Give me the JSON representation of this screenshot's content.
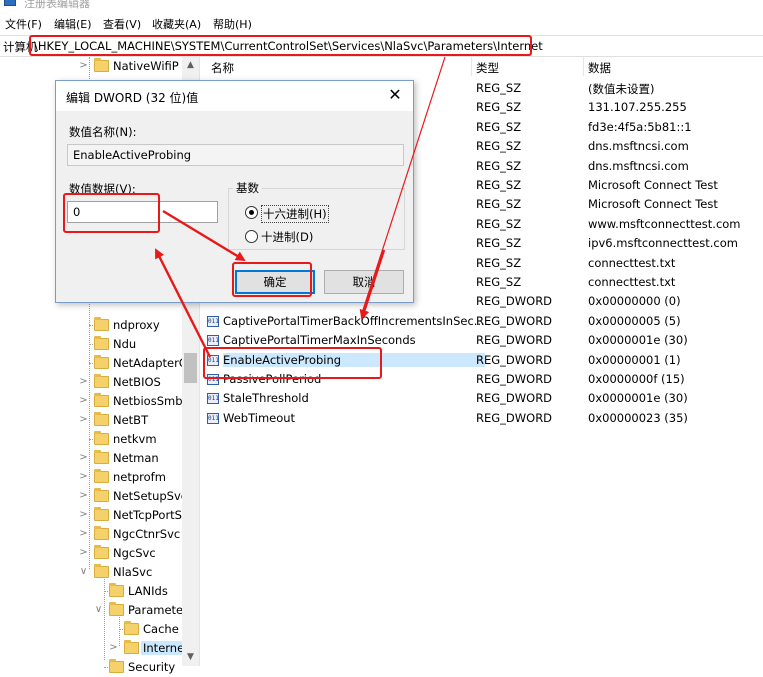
{
  "app": {
    "title": "注册表编辑器"
  },
  "menu": [
    "文件(F)",
    "编辑(E)",
    "查看(V)",
    "收藏夹(A)",
    "帮助(H)"
  ],
  "address": {
    "label": "计算机",
    "path": "\\HKEY_LOCAL_MACHINE\\SYSTEM\\CurrentControlSet\\Services\\NlaSvc\\Parameters\\Internet"
  },
  "tree": {
    "items": [
      {
        "label": "NativeWifiP",
        "has_children": true
      },
      {
        "label": "ndproxy",
        "has_children": false
      },
      {
        "label": "Ndu",
        "has_children": false
      },
      {
        "label": "NetAdapterC",
        "has_children": false
      },
      {
        "label": "NetBIOS",
        "has_children": true
      },
      {
        "label": "NetbiosSmb",
        "has_children": true
      },
      {
        "label": "NetBT",
        "has_children": true
      },
      {
        "label": "netkvm",
        "has_children": false
      },
      {
        "label": "Netman",
        "has_children": true
      },
      {
        "label": "netprofm",
        "has_children": true
      },
      {
        "label": "NetSetupSvc",
        "has_children": true
      },
      {
        "label": "NetTcpPortSl",
        "has_children": true
      },
      {
        "label": "NgcCtnrSvc",
        "has_children": true
      },
      {
        "label": "NgcSvc",
        "has_children": true
      },
      {
        "label": "NlaSvc",
        "expanded": true
      },
      {
        "label": "LANIds",
        "has_children": false
      },
      {
        "label": "Parameter",
        "expanded": true
      },
      {
        "label": "Cache",
        "has_children": false
      },
      {
        "label": "Internet",
        "has_children": true,
        "selected": true
      },
      {
        "label": "Security",
        "has_children": false
      }
    ]
  },
  "list": {
    "columns": {
      "name": "名称",
      "type": "类型",
      "data": "数据"
    },
    "rows": [
      {
        "name": "",
        "type": "REG_SZ",
        "data": "(数值未设置)"
      },
      {
        "name": "",
        "type": "REG_SZ",
        "data": "131.107.255.255"
      },
      {
        "name": "",
        "type": "REG_SZ",
        "data": "fd3e:4f5a:5b81::1"
      },
      {
        "name": "",
        "type": "REG_SZ",
        "data": "dns.msftncsi.com"
      },
      {
        "name": "",
        "type": "REG_SZ",
        "data": "dns.msftncsi.com"
      },
      {
        "name": "",
        "type": "REG_SZ",
        "data": "Microsoft Connect Test"
      },
      {
        "name": "",
        "type": "REG_SZ",
        "data": "Microsoft Connect Test"
      },
      {
        "name": "",
        "type": "REG_SZ",
        "data": "www.msftconnecttest.com"
      },
      {
        "name": "",
        "type": "REG_SZ",
        "data": "ipv6.msftconnecttest.com"
      },
      {
        "name": "",
        "type": "REG_SZ",
        "data": "connecttest.txt"
      },
      {
        "name": "",
        "type": "REG_SZ",
        "data": "connecttest.txt"
      },
      {
        "name": "",
        "type": "REG_DWORD",
        "data": "0x00000000 (0)"
      },
      {
        "name": "CaptivePortalTimerBackOffIncrementsInSec...",
        "type": "REG_DWORD",
        "data": "0x00000005 (5)"
      },
      {
        "name": "CaptivePortalTimerMaxInSeconds",
        "type": "REG_DWORD",
        "data": "0x0000001e (30)"
      },
      {
        "name": "EnableActiveProbing",
        "type": "REG_DWORD",
        "data": "0x00000001 (1)",
        "selected": true
      },
      {
        "name": "PassivePollPeriod",
        "type": "REG_DWORD",
        "data": "0x0000000f (15)"
      },
      {
        "name": "StaleThreshold",
        "type": "REG_DWORD",
        "data": "0x0000001e (30)"
      },
      {
        "name": "WebTimeout",
        "type": "REG_DWORD",
        "data": "0x00000023 (35)"
      }
    ]
  },
  "dialog": {
    "title": "编辑 DWORD (32 位)值",
    "value_name_label": "数值名称(N):",
    "value_name": "EnableActiveProbing",
    "value_data_label": "数值数据(V):",
    "value_data": "0",
    "base_label": "基数",
    "hex_label": "十六进制(H)",
    "dec_label": "十进制(D)",
    "base_selected": "hex",
    "ok_label": "确定",
    "cancel_label": "取消"
  },
  "colors": {
    "highlight": "#e8191b",
    "selection": "#cce8ff",
    "folder": "#f4d16a"
  },
  "icons": {
    "reg_value": "reg-binary-icon",
    "folder": "folder-icon"
  }
}
